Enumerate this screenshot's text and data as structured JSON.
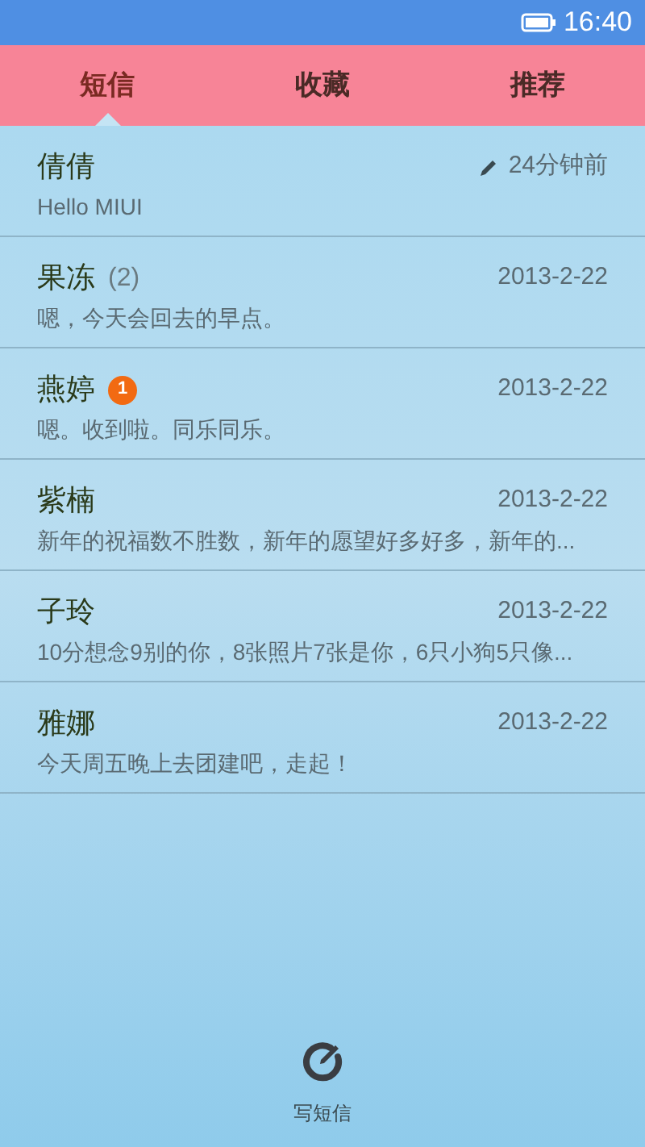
{
  "status_bar": {
    "time": "16:40"
  },
  "tabs": [
    {
      "label": "短信",
      "selected": true
    },
    {
      "label": "收藏",
      "selected": false
    },
    {
      "label": "推荐",
      "selected": false
    }
  ],
  "conversations": [
    {
      "name": "倩倩",
      "draft": true,
      "time": "24分钟前",
      "preview": "Hello MIUI"
    },
    {
      "name": "果冻",
      "count": "(2)",
      "draft": false,
      "time": "2013-2-22",
      "preview": "嗯，今天会回去的早点。"
    },
    {
      "name": "燕婷",
      "unread": "1",
      "draft": false,
      "time": "2013-2-22",
      "preview": "嗯。收到啦。同乐同乐。"
    },
    {
      "name": "紫楠",
      "draft": false,
      "time": "2013-2-22",
      "preview": "新年的祝福数不胜数，新年的愿望好多好多，新年的..."
    },
    {
      "name": "子玲",
      "draft": false,
      "time": "2013-2-22",
      "preview": "10分想念9别的你，8张照片7张是你，6只小狗5只像..."
    },
    {
      "name": "雅娜",
      "draft": false,
      "time": "2013-2-22",
      "preview": "今天周五晚上去团建吧，走起！"
    }
  ],
  "compose": {
    "label": "写短信"
  }
}
